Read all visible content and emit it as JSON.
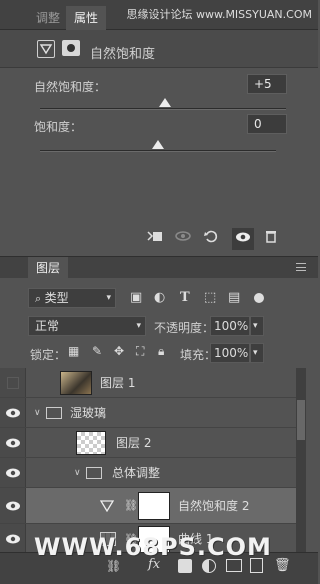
{
  "tabs": {
    "adjust": "调整",
    "properties": "属性"
  },
  "watermark": "思缘设计论坛 www.MISSYUAN.COM",
  "props": {
    "header_title": "自然饱和度",
    "vibrance_label": "自然饱和度：",
    "vibrance_value": "+5",
    "vibrance_level": 0.5,
    "saturation_label": "饱和度：",
    "saturation_value": "0",
    "saturation_level": 0.5
  },
  "props_toolbar": {
    "clip_icon": "clip-to-layer-icon",
    "view_prev_icon": "view-previous-state-icon",
    "reset_icon": "reset-icon",
    "visibility_icon": "eye-icon",
    "delete_icon": "trash-icon"
  },
  "layers_panel": {
    "title": "图层",
    "filter_kind": "类型",
    "blend_mode": "正常",
    "opacity_label": "不透明度：",
    "opacity_value": "100%",
    "lock_label": "锁定：",
    "fill_label": "填充：",
    "fill_value": "100%"
  },
  "layers": [
    {
      "name": "图层 1",
      "visible": false,
      "type": "image"
    },
    {
      "name": "湿玻璃",
      "visible": true,
      "type": "group"
    },
    {
      "name": "图层 2",
      "visible": true,
      "type": "transparent"
    },
    {
      "name": "总体调整",
      "visible": true,
      "type": "group"
    },
    {
      "name": "自然饱和度 2",
      "visible": true,
      "type": "adjustment"
    },
    {
      "name": "曲线 1",
      "visible": true,
      "type": "curves"
    }
  ],
  "footer_watermark": "WWW.68PS.COM"
}
